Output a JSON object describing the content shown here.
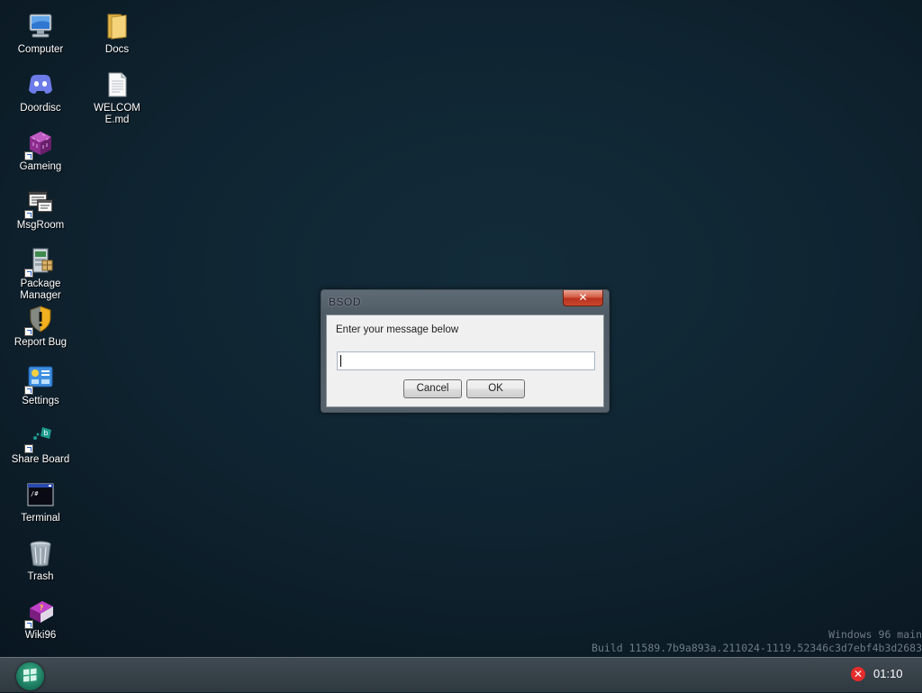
{
  "desktop": {
    "icons": [
      {
        "label": "Computer",
        "icon": "computer-icon"
      },
      {
        "label": "Docs",
        "icon": "folder-icon"
      },
      {
        "label": "Doordisc",
        "icon": "doordisc-icon"
      },
      {
        "label": "WELCOME.md",
        "icon": "document-icon"
      },
      {
        "label": "Gameing",
        "icon": "game-cube-icon"
      },
      {
        "label": "MsgRoom",
        "icon": "msgroom-icon"
      },
      {
        "label": "Package Manager",
        "icon": "package-icon"
      },
      {
        "label": "Report Bug",
        "icon": "shield-warning-icon"
      },
      {
        "label": "Settings",
        "icon": "settings-icon"
      },
      {
        "label": "Share Board",
        "icon": "share-board-icon"
      },
      {
        "label": "Terminal",
        "icon": "terminal-icon"
      },
      {
        "label": "Trash",
        "icon": "trash-icon"
      },
      {
        "label": "Wiki96",
        "icon": "wiki-book-icon"
      }
    ],
    "build_info": {
      "line1": "Windows 96 main",
      "line2": "Build 11589.7b9a893a.211024-1119.52346c3d7ebf4b3d2683"
    }
  },
  "dialog": {
    "title": "BSOD",
    "close_label": "✕",
    "prompt": "Enter your message below",
    "input_value": "",
    "cancel_label": "Cancel",
    "ok_label": "OK"
  },
  "taskbar": {
    "start_icon": "start-orb-icon",
    "tray_icon": "error-icon",
    "clock": "01:10"
  }
}
